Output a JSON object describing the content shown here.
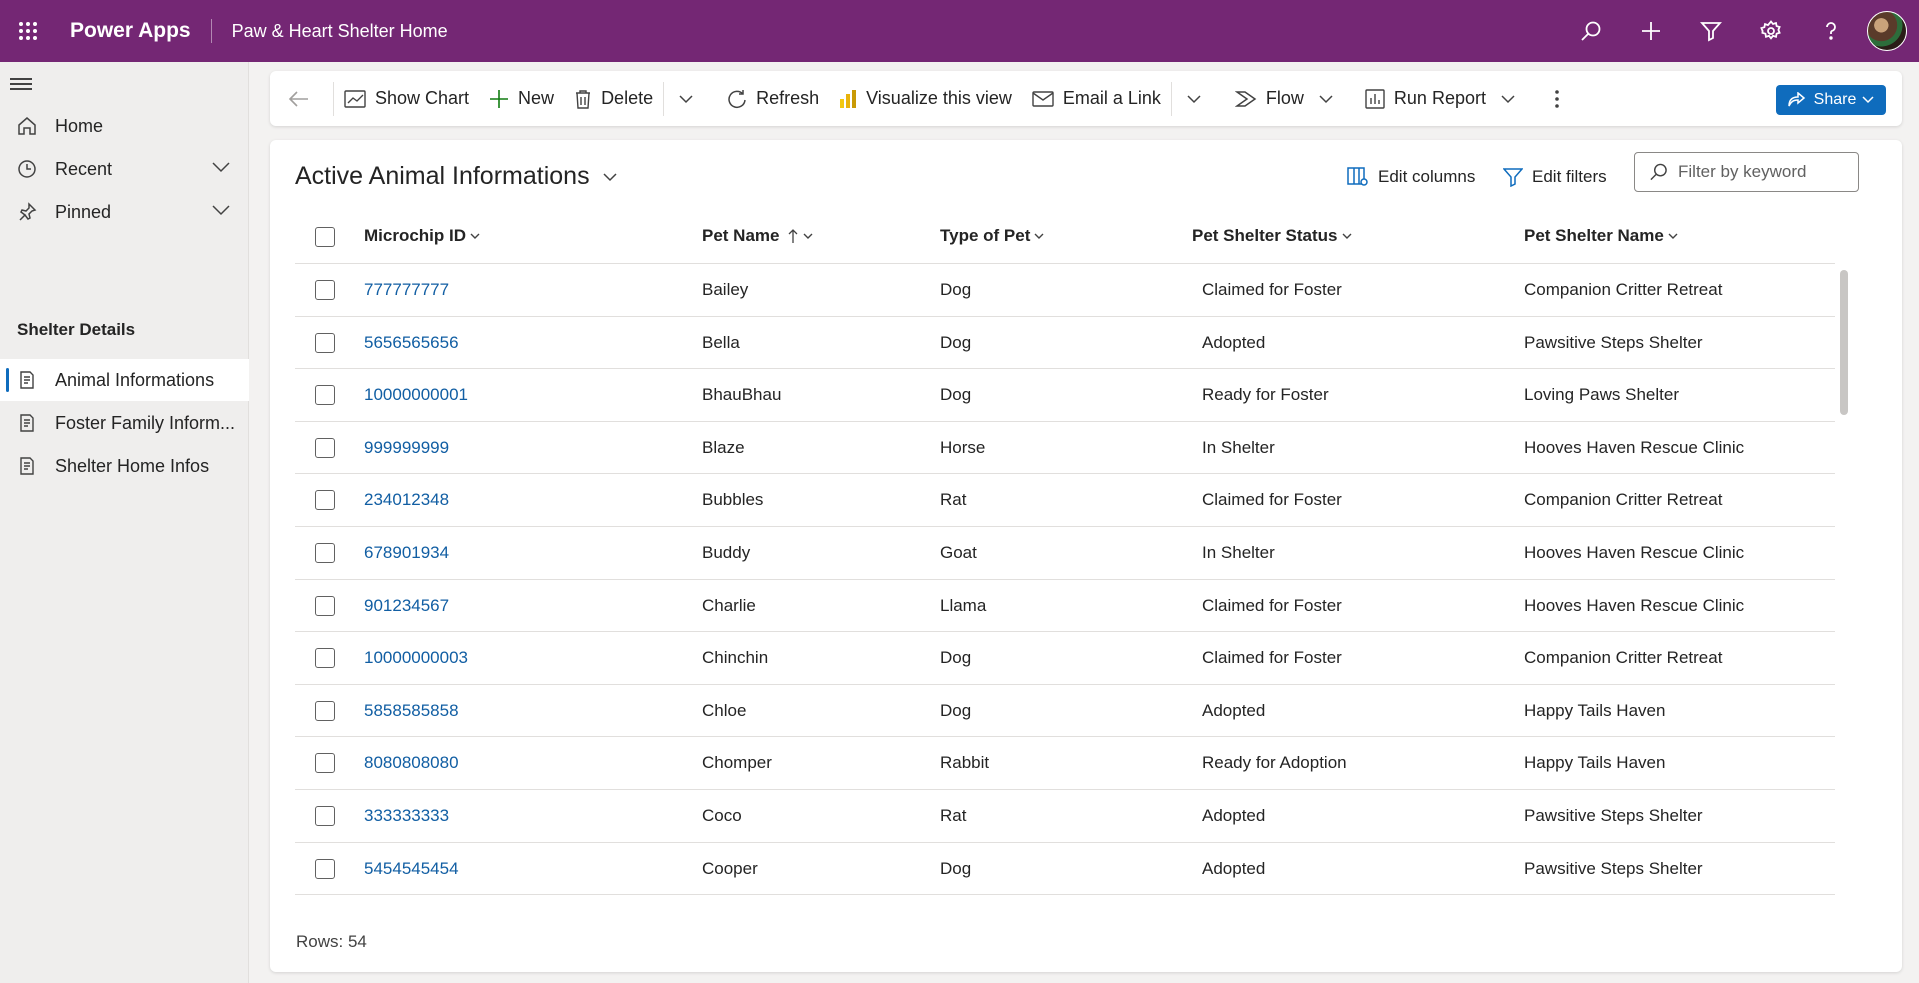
{
  "topbar": {
    "app_name": "Power Apps",
    "environment": "Paw & Heart Shelter Home",
    "icons": [
      "search-icon",
      "plus-icon",
      "filter-icon",
      "settings-icon",
      "help-icon"
    ]
  },
  "sidebar": {
    "nav": [
      {
        "label": "Home",
        "icon": "home-icon"
      },
      {
        "label": "Recent",
        "icon": "clock-icon"
      },
      {
        "label": "Pinned",
        "icon": "pin-icon"
      }
    ],
    "section_title": "Shelter Details",
    "entities": [
      {
        "label": "Animal Informations",
        "icon": "entity-icon",
        "active": true
      },
      {
        "label": "Foster Family Inform...",
        "icon": "entity-icon",
        "active": false
      },
      {
        "label": "Shelter Home Infos",
        "icon": "entity-icon",
        "active": false
      }
    ]
  },
  "commandbar": {
    "show_chart": "Show Chart",
    "new": "New",
    "delete": "Delete",
    "refresh": "Refresh",
    "visualize": "Visualize this view",
    "email_link": "Email a Link",
    "flow": "Flow",
    "run_report": "Run Report",
    "share": "Share"
  },
  "view": {
    "title": "Active Animal Informations",
    "edit_columns": "Edit columns",
    "edit_filters": "Edit filters",
    "filter_placeholder": "Filter by keyword",
    "columns": [
      "Microchip ID",
      "Pet Name",
      "Type of Pet",
      "Pet Shelter Status",
      "Pet Shelter Name"
    ],
    "rows": [
      {
        "id": "777777777",
        "name": "Bailey",
        "type": "Dog",
        "status": "Claimed for Foster",
        "shelter": "Companion Critter Retreat"
      },
      {
        "id": "5656565656",
        "name": "Bella",
        "type": "Dog",
        "status": "Adopted",
        "shelter": "Pawsitive Steps Shelter"
      },
      {
        "id": "10000000001",
        "name": "BhauBhau",
        "type": "Dog",
        "status": "Ready for Foster",
        "shelter": "Loving Paws Shelter"
      },
      {
        "id": "999999999",
        "name": "Blaze",
        "type": "Horse",
        "status": "In Shelter",
        "shelter": "Hooves Haven Rescue Clinic"
      },
      {
        "id": "234012348",
        "name": "Bubbles",
        "type": "Rat",
        "status": "Claimed for Foster",
        "shelter": "Companion Critter Retreat"
      },
      {
        "id": "678901934",
        "name": "Buddy",
        "type": "Goat",
        "status": "In Shelter",
        "shelter": "Hooves Haven Rescue Clinic"
      },
      {
        "id": "901234567",
        "name": "Charlie",
        "type": "Llama",
        "status": "Claimed for Foster",
        "shelter": "Hooves Haven Rescue Clinic"
      },
      {
        "id": "10000000003",
        "name": "Chinchin",
        "type": "Dog",
        "status": "Claimed for Foster",
        "shelter": "Companion Critter Retreat"
      },
      {
        "id": "5858585858",
        "name": "Chloe",
        "type": "Dog",
        "status": "Adopted",
        "shelter": "Happy Tails Haven"
      },
      {
        "id": "8080808080",
        "name": "Chomper",
        "type": "Rabbit",
        "status": "Ready for Adoption",
        "shelter": "Happy Tails Haven"
      },
      {
        "id": "333333333",
        "name": "Coco",
        "type": "Rat",
        "status": "Adopted",
        "shelter": "Pawsitive Steps Shelter"
      },
      {
        "id": "5454545454",
        "name": "Cooper",
        "type": "Dog",
        "status": "Adopted",
        "shelter": "Pawsitive Steps Shelter"
      }
    ],
    "rows_count": "Rows: 54"
  }
}
